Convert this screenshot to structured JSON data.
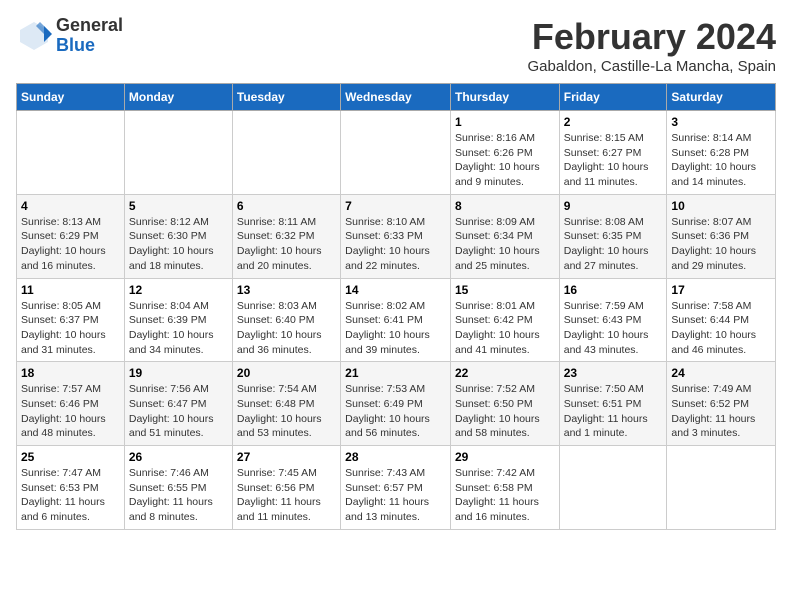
{
  "header": {
    "logo_general": "General",
    "logo_blue": "Blue",
    "month_year": "February 2024",
    "location": "Gabaldon, Castille-La Mancha, Spain"
  },
  "days_of_week": [
    "Sunday",
    "Monday",
    "Tuesday",
    "Wednesday",
    "Thursday",
    "Friday",
    "Saturday"
  ],
  "weeks": [
    [
      {
        "day": "",
        "info": ""
      },
      {
        "day": "",
        "info": ""
      },
      {
        "day": "",
        "info": ""
      },
      {
        "day": "",
        "info": ""
      },
      {
        "day": "1",
        "info": "Sunrise: 8:16 AM\nSunset: 6:26 PM\nDaylight: 10 hours\nand 9 minutes."
      },
      {
        "day": "2",
        "info": "Sunrise: 8:15 AM\nSunset: 6:27 PM\nDaylight: 10 hours\nand 11 minutes."
      },
      {
        "day": "3",
        "info": "Sunrise: 8:14 AM\nSunset: 6:28 PM\nDaylight: 10 hours\nand 14 minutes."
      }
    ],
    [
      {
        "day": "4",
        "info": "Sunrise: 8:13 AM\nSunset: 6:29 PM\nDaylight: 10 hours\nand 16 minutes."
      },
      {
        "day": "5",
        "info": "Sunrise: 8:12 AM\nSunset: 6:30 PM\nDaylight: 10 hours\nand 18 minutes."
      },
      {
        "day": "6",
        "info": "Sunrise: 8:11 AM\nSunset: 6:32 PM\nDaylight: 10 hours\nand 20 minutes."
      },
      {
        "day": "7",
        "info": "Sunrise: 8:10 AM\nSunset: 6:33 PM\nDaylight: 10 hours\nand 22 minutes."
      },
      {
        "day": "8",
        "info": "Sunrise: 8:09 AM\nSunset: 6:34 PM\nDaylight: 10 hours\nand 25 minutes."
      },
      {
        "day": "9",
        "info": "Sunrise: 8:08 AM\nSunset: 6:35 PM\nDaylight: 10 hours\nand 27 minutes."
      },
      {
        "day": "10",
        "info": "Sunrise: 8:07 AM\nSunset: 6:36 PM\nDaylight: 10 hours\nand 29 minutes."
      }
    ],
    [
      {
        "day": "11",
        "info": "Sunrise: 8:05 AM\nSunset: 6:37 PM\nDaylight: 10 hours\nand 31 minutes."
      },
      {
        "day": "12",
        "info": "Sunrise: 8:04 AM\nSunset: 6:39 PM\nDaylight: 10 hours\nand 34 minutes."
      },
      {
        "day": "13",
        "info": "Sunrise: 8:03 AM\nSunset: 6:40 PM\nDaylight: 10 hours\nand 36 minutes."
      },
      {
        "day": "14",
        "info": "Sunrise: 8:02 AM\nSunset: 6:41 PM\nDaylight: 10 hours\nand 39 minutes."
      },
      {
        "day": "15",
        "info": "Sunrise: 8:01 AM\nSunset: 6:42 PM\nDaylight: 10 hours\nand 41 minutes."
      },
      {
        "day": "16",
        "info": "Sunrise: 7:59 AM\nSunset: 6:43 PM\nDaylight: 10 hours\nand 43 minutes."
      },
      {
        "day": "17",
        "info": "Sunrise: 7:58 AM\nSunset: 6:44 PM\nDaylight: 10 hours\nand 46 minutes."
      }
    ],
    [
      {
        "day": "18",
        "info": "Sunrise: 7:57 AM\nSunset: 6:46 PM\nDaylight: 10 hours\nand 48 minutes."
      },
      {
        "day": "19",
        "info": "Sunrise: 7:56 AM\nSunset: 6:47 PM\nDaylight: 10 hours\nand 51 minutes."
      },
      {
        "day": "20",
        "info": "Sunrise: 7:54 AM\nSunset: 6:48 PM\nDaylight: 10 hours\nand 53 minutes."
      },
      {
        "day": "21",
        "info": "Sunrise: 7:53 AM\nSunset: 6:49 PM\nDaylight: 10 hours\nand 56 minutes."
      },
      {
        "day": "22",
        "info": "Sunrise: 7:52 AM\nSunset: 6:50 PM\nDaylight: 10 hours\nand 58 minutes."
      },
      {
        "day": "23",
        "info": "Sunrise: 7:50 AM\nSunset: 6:51 PM\nDaylight: 11 hours\nand 1 minute."
      },
      {
        "day": "24",
        "info": "Sunrise: 7:49 AM\nSunset: 6:52 PM\nDaylight: 11 hours\nand 3 minutes."
      }
    ],
    [
      {
        "day": "25",
        "info": "Sunrise: 7:47 AM\nSunset: 6:53 PM\nDaylight: 11 hours\nand 6 minutes."
      },
      {
        "day": "26",
        "info": "Sunrise: 7:46 AM\nSunset: 6:55 PM\nDaylight: 11 hours\nand 8 minutes."
      },
      {
        "day": "27",
        "info": "Sunrise: 7:45 AM\nSunset: 6:56 PM\nDaylight: 11 hours\nand 11 minutes."
      },
      {
        "day": "28",
        "info": "Sunrise: 7:43 AM\nSunset: 6:57 PM\nDaylight: 11 hours\nand 13 minutes."
      },
      {
        "day": "29",
        "info": "Sunrise: 7:42 AM\nSunset: 6:58 PM\nDaylight: 11 hours\nand 16 minutes."
      },
      {
        "day": "",
        "info": ""
      },
      {
        "day": "",
        "info": ""
      }
    ]
  ]
}
